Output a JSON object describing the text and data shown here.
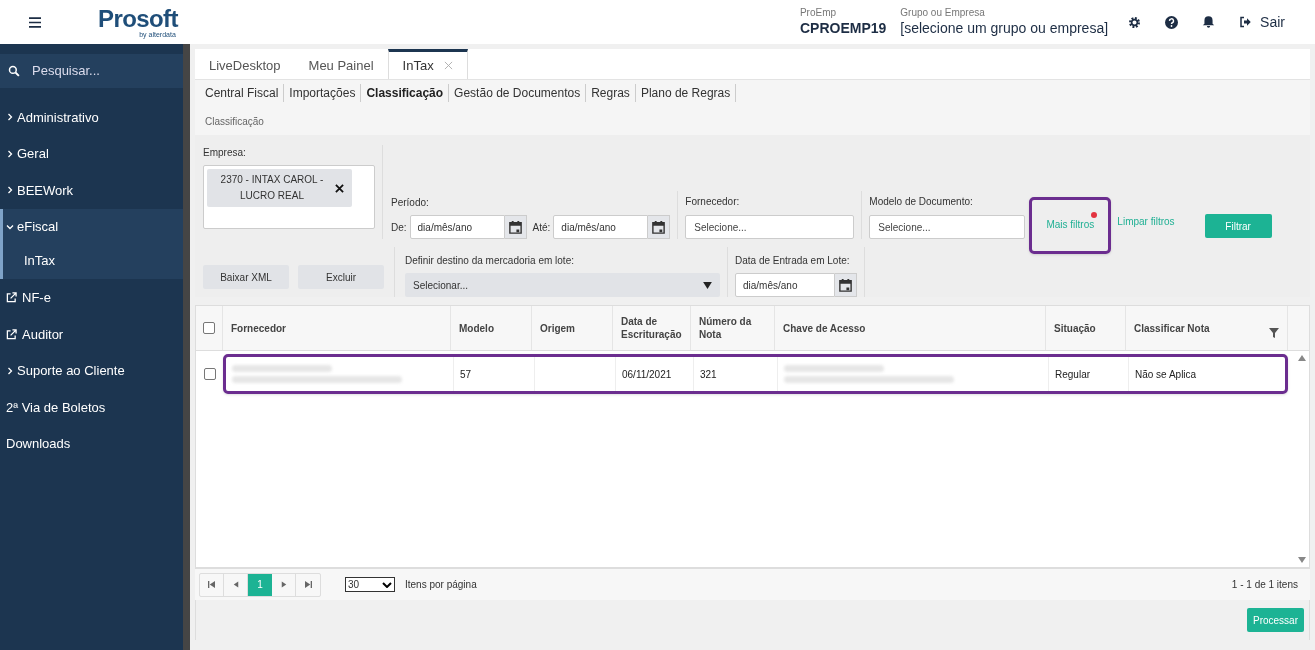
{
  "header": {
    "logo": {
      "name": "Prosoft",
      "tagline": "by alterdata"
    },
    "proemp": {
      "label": "ProEmp",
      "value": "CPROEMP19"
    },
    "grupo": {
      "label": "Grupo ou Empresa",
      "value": "[selecione um grupo ou empresa]"
    },
    "logout": "Sair"
  },
  "sidebar": {
    "search_placeholder": "Pesquisar...",
    "items": [
      {
        "label": "Administrativo",
        "kind": "group",
        "expanded": false
      },
      {
        "label": "Geral",
        "kind": "group",
        "expanded": false
      },
      {
        "label": "BEEWork",
        "kind": "group",
        "expanded": false
      },
      {
        "label": "eFiscal",
        "kind": "group",
        "expanded": true,
        "children": [
          {
            "label": "InTax"
          }
        ]
      },
      {
        "label": "NF-e",
        "kind": "external"
      },
      {
        "label": "Auditor",
        "kind": "external"
      },
      {
        "label": "Suporte ao Cliente",
        "kind": "group",
        "expanded": false
      },
      {
        "label": "2ª Via de Boletos",
        "kind": "plain"
      },
      {
        "label": "Downloads",
        "kind": "plain"
      }
    ]
  },
  "tabs": [
    {
      "label": "LiveDesktop",
      "selected": false,
      "closable": false
    },
    {
      "label": "Meu Painel",
      "selected": false,
      "closable": false
    },
    {
      "label": "InTax",
      "selected": true,
      "closable": true
    }
  ],
  "subnav": [
    {
      "label": "Central Fiscal",
      "selected": false
    },
    {
      "label": "Importações",
      "selected": false
    },
    {
      "label": "Classificação",
      "selected": true
    },
    {
      "label": "Gestão de Documentos",
      "selected": false
    },
    {
      "label": "Regras",
      "selected": false
    },
    {
      "label": "Plano de Regras",
      "selected": false
    }
  ],
  "breadcrumb": "Classificação",
  "filters": {
    "empresa": {
      "label": "Empresa:",
      "chip": "2370 - INTAX CAROL - LUCRO REAL"
    },
    "periodo": {
      "label": "Período:",
      "from_label": "De:",
      "from_placeholder": "dia/mês/ano",
      "to_label": "Até:",
      "to_placeholder": "dia/mês/ano"
    },
    "fornecedor": {
      "label": "Fornecedor:",
      "placeholder": "Selecione..."
    },
    "modelo": {
      "label": "Modelo de Documento:",
      "placeholder": "Selecione..."
    },
    "mais_filtros": {
      "label": "Mais filtros",
      "indicator": true
    },
    "limpar": "Limpar filtros",
    "filtrar": "Filtrar",
    "actions": [
      "Baixar XML",
      "Excluir"
    ],
    "destino": {
      "label": "Definir destino da mercadoria em lote:",
      "value": "Selecionar..."
    },
    "data_entrada": {
      "label": "Data de Entrada em Lote:",
      "placeholder": "dia/mês/ano"
    }
  },
  "table": {
    "select_all_checked": false,
    "columns": [
      "Fornecedor",
      "Modelo",
      "Origem",
      "Data de Escrituração",
      "Número da Nota",
      "Chave de Acesso",
      "Situação",
      "Classificar Nota"
    ],
    "rows": [
      {
        "checked": false,
        "highlighted": true,
        "cells": [
          {
            "kind": "blurred"
          },
          {
            "kind": "text",
            "text": "57"
          },
          {
            "kind": "empty"
          },
          {
            "kind": "text",
            "text": "06/11/2021"
          },
          {
            "kind": "text",
            "text": "321"
          },
          {
            "kind": "blurred"
          },
          {
            "kind": "text",
            "text": "Regular"
          },
          {
            "kind": "text",
            "text": "Não se Aplica"
          }
        ]
      }
    ]
  },
  "pagination": {
    "pages": [
      {
        "label": "1",
        "selected": true
      }
    ],
    "page_size": "30",
    "per_page_label": "Itens por página",
    "summary": "1 - 1 de 1 itens"
  },
  "process_button": "Processar"
}
